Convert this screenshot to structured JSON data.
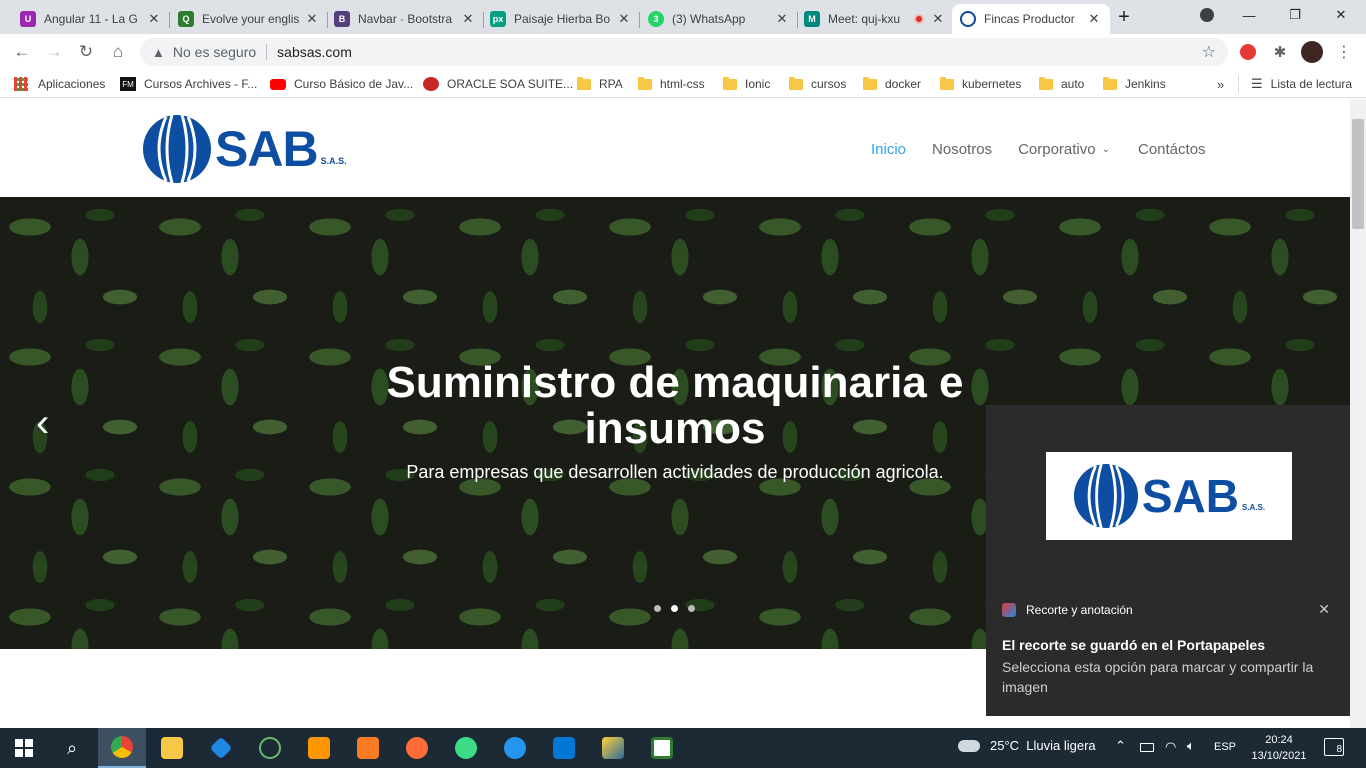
{
  "browser": {
    "tabs": [
      {
        "title": "Angular 11 - La G",
        "color": "#9c27b0",
        "glyph": "U"
      },
      {
        "title": "Evolve your englis",
        "color": "#2e7d32",
        "glyph": "Q"
      },
      {
        "title": "Navbar · Bootstra",
        "color": "#563d7c",
        "glyph": "B"
      },
      {
        "title": "Paisaje Hierba Bo",
        "color": "#05a081",
        "glyph": "px"
      },
      {
        "title": "(3) WhatsApp",
        "color": "#25d366",
        "glyph": "3"
      },
      {
        "title": "Meet: quj-kxu",
        "color": "#00897b",
        "glyph": "M"
      },
      {
        "title": "Fincas Productor",
        "color": "#0d47a1",
        "glyph": ""
      }
    ],
    "security_label": "No es seguro",
    "url": "sabsas.com",
    "bookmarks": [
      "Aplicaciones",
      "Cursos Archives - F...",
      "Curso Básico de Jav...",
      "ORACLE SOA SUITE...",
      "RPA",
      "html-css",
      "Ionic",
      "cursos",
      "docker",
      "kubernetes",
      "auto",
      "Jenkins"
    ],
    "reading_list": "Lista de lectura"
  },
  "site": {
    "logo_text": "SAB",
    "logo_suffix": "S.A.S.",
    "nav": [
      "Inicio",
      "Nosotros",
      "Corporativo",
      "Contáctos"
    ],
    "hero_title": "Suministro de maquinaria e insumos",
    "hero_subtitle": "Para empresas que desarrollen actividades de producción agricola.",
    "carousel_prev": "‹"
  },
  "toast": {
    "app_name": "Recorte y anotación",
    "title": "El recorte se guardó en el Portapapeles",
    "body": "Selecciona esta opción para marcar y compartir la imagen"
  },
  "taskbar": {
    "weather": "25°C  Lluvia ligera",
    "language": "ESP",
    "time": "20:24",
    "date": "13/10/2021",
    "notifications": "8"
  },
  "colors": {
    "brand": "#0d4ea3",
    "nav_active": "#2ea3f2"
  }
}
